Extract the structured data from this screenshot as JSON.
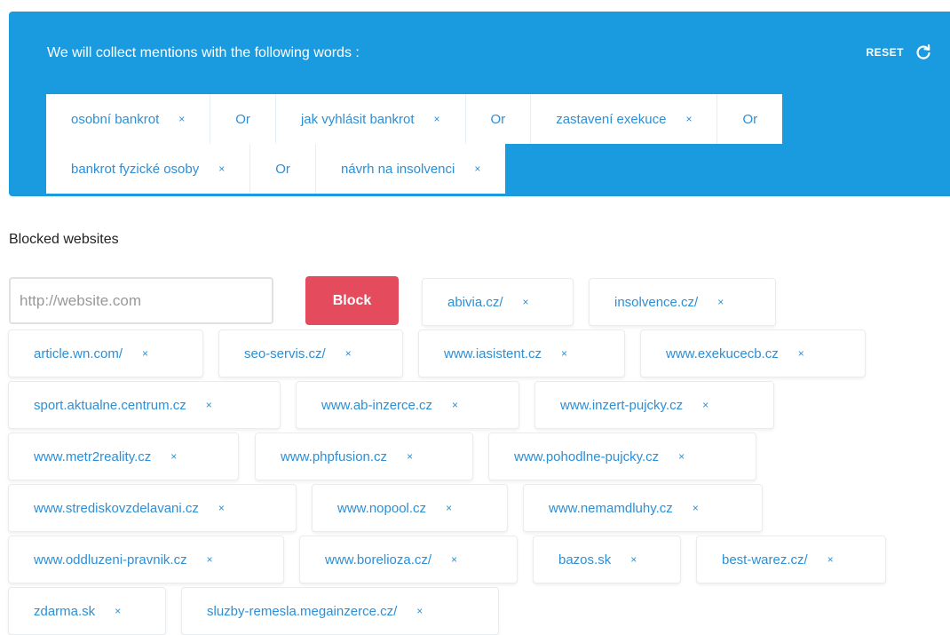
{
  "keywords": {
    "title": "We will collect mentions with the following words :",
    "reset_label": "RESET",
    "reset_icon": "refresh-icon",
    "operator": "Or",
    "remove_glyph": "×",
    "row1": [
      "osobní bankrot",
      "jak vyhlásit bankrot",
      "zastavení exekuce"
    ],
    "row2": [
      "bankrot fyzické osoby",
      "návrh na insolvenci"
    ]
  },
  "blocked": {
    "title": "Blocked websites",
    "input_value": "http://",
    "input_placeholder": "website.com",
    "block_label": "Block",
    "sites": [
      "abivia.cz/",
      "insolvence.cz/",
      "article.wn.com/",
      "seo-servis.cz/",
      "www.iasistent.cz",
      "www.exekucecb.cz",
      "sport.aktualne.centrum.cz",
      "www.ab-inzerce.cz",
      "www.inzert-pujcky.cz",
      "www.metr2reality.cz",
      "www.phpfusion.cz",
      "www.pohodlne-pujcky.cz",
      "www.strediskovzdelavani.cz",
      "www.nopool.cz",
      "www.nemamdluhy.cz",
      "www.oddluzeni-pravnik.cz",
      "www.borelioza.cz/",
      "bazos.sk",
      "best-warez.cz/",
      "zdarma.sk",
      "sluzby-remesla.megainzerce.cz/"
    ]
  },
  "colors": {
    "panel": "#1a9be0",
    "link": "#2d8fd5",
    "block_button": "#e44b5d"
  }
}
